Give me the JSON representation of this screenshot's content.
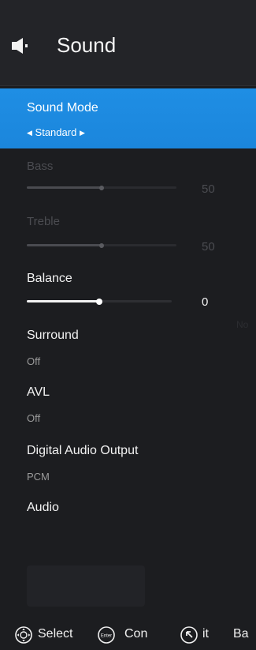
{
  "header": {
    "title": "Sound",
    "icon": "speaker-icon"
  },
  "items": {
    "sound_mode": {
      "label": "Sound Mode",
      "value": "Standard"
    },
    "bass": {
      "label": "Bass",
      "value": "50",
      "level": 0.5
    },
    "treble": {
      "label": "Treble",
      "value": "50",
      "level": 0.5
    },
    "balance": {
      "label": "Balance",
      "value": "0",
      "level": 0.5
    },
    "surround": {
      "label": "Surround",
      "value": "Off"
    },
    "avl": {
      "label": "AVL",
      "value": "Off"
    },
    "digital_audio_output": {
      "label": "Digital Audio Output",
      "value": "PCM"
    },
    "audio": {
      "label": "Audio"
    }
  },
  "background_ghost_text": "No",
  "footer": {
    "select_label": "Select",
    "enter_icon_text": "Enter",
    "confirm_label": "Con",
    "exit_label": "it",
    "back_label": "Ba"
  },
  "colors": {
    "accent": "#1b86dc",
    "background": "#1c1d20",
    "disabled": "#4b4c51"
  }
}
